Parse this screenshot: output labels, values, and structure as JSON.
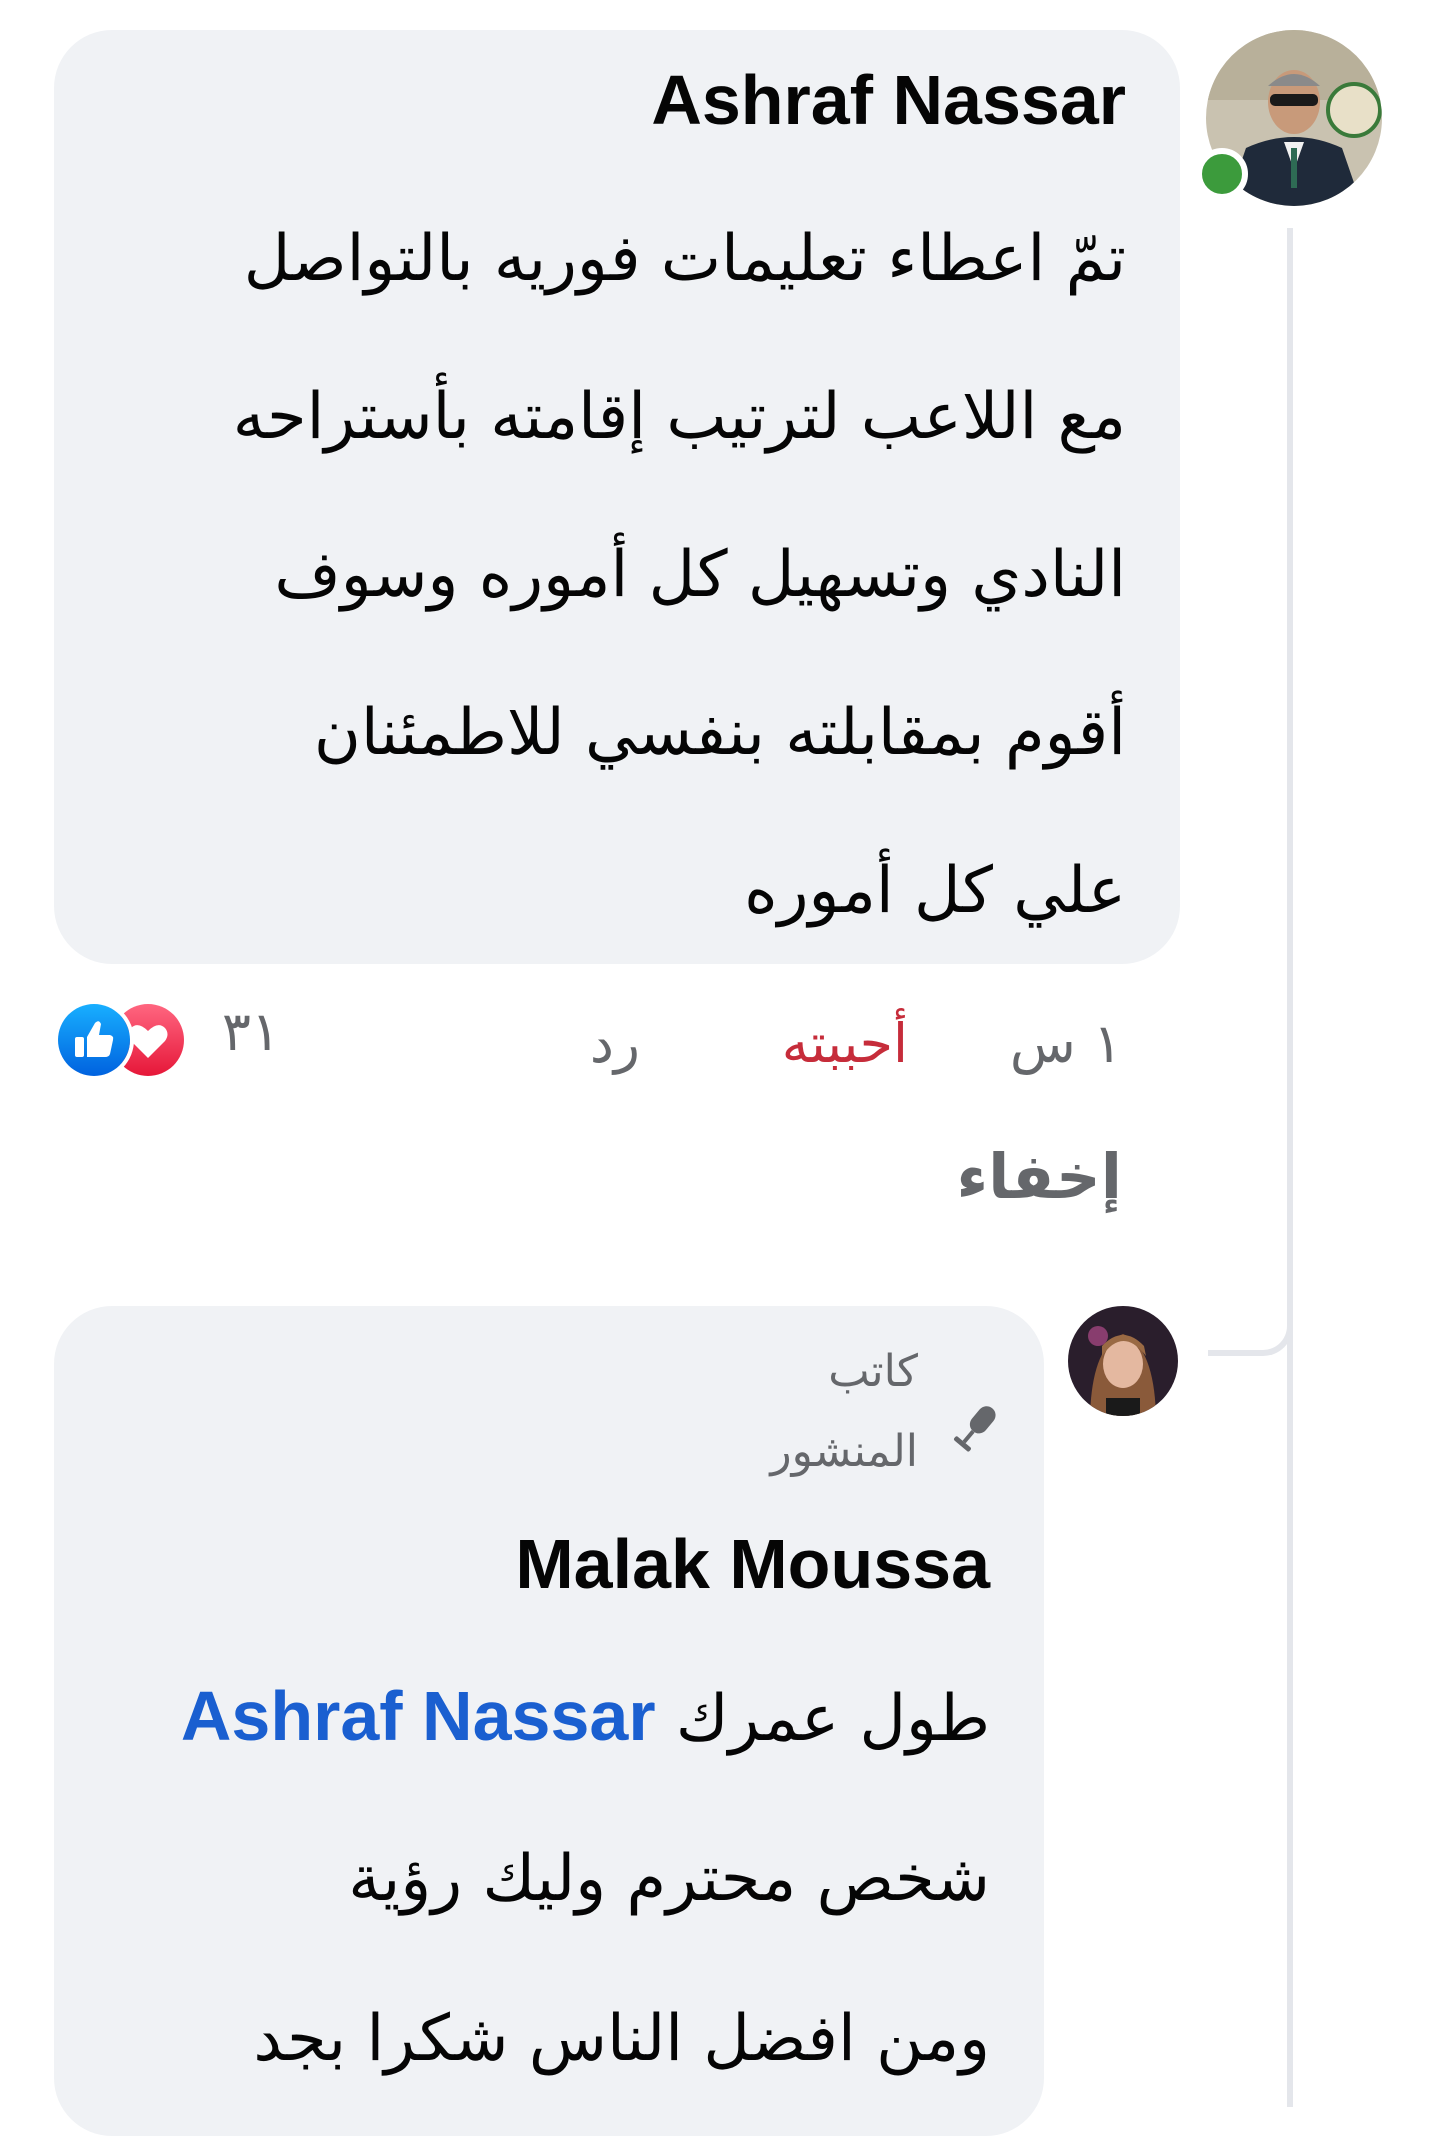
{
  "comments": [
    {
      "author": "Ashraf Nassar",
      "lines": [
        "تمّ اعطاء تعليمات فوريه بالتواصل",
        "مع اللاعب لترتيب إقامته بأستراحه",
        "النادي وتسهيل كل أموره وسوف",
        "أقوم بمقابلته بنفسي للاطمئنان",
        "علي كل أموره"
      ],
      "time": "١ س",
      "like_label": "أحببته",
      "reply_label": "رد",
      "reaction_count": "٣١",
      "reactions": [
        "like-icon",
        "heart-icon"
      ],
      "online": true
    }
  ],
  "replies_toggle": "إخفاء",
  "reply": {
    "badge_line1": "كاتب",
    "badge_line2": "المنشور",
    "badge_icon": "microphone-icon",
    "author": "Malak Moussa",
    "line1_text": "طول عمرك",
    "mention": "Ashraf Nassar",
    "lines": [
      "شخص محترم وليك رؤية",
      "ومن افضل الناس شكرا بجد"
    ]
  },
  "colors": {
    "bubble": "#f0f2f5",
    "like_active": "#c62c3a",
    "mention": "#1a5fd0",
    "secondary_text": "#65676b",
    "online": "#3c9b3c"
  }
}
